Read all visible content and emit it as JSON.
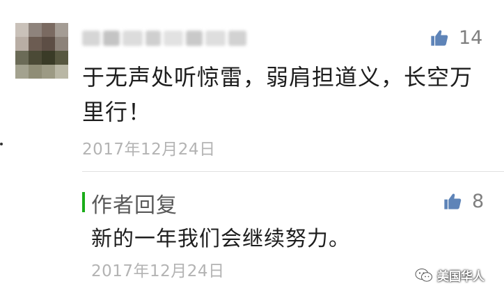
{
  "comment": {
    "like_count": "14",
    "text": "于无声处听惊雷，弱肩担道义，长空万里行！",
    "date": "2017年12月24日"
  },
  "reply": {
    "label": "作者回复",
    "like_count": "8",
    "text": "新的一年我们会继续努力。",
    "date": "2017年12月24日"
  },
  "watermark": {
    "text": "美国华人"
  },
  "colors": {
    "accent_green": "#1aad19",
    "like_icon": "#5e84b8",
    "date_gray": "#b3b3b3"
  }
}
